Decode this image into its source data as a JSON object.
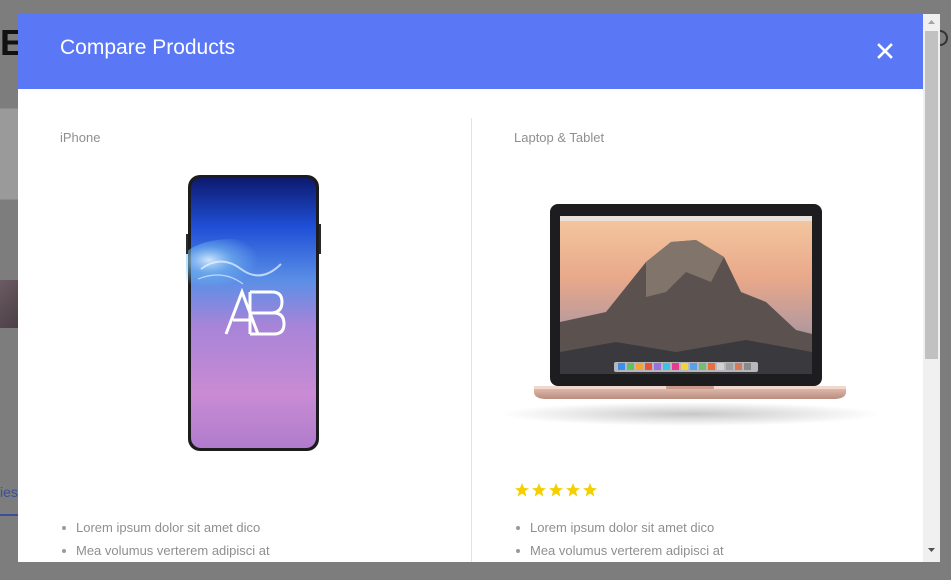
{
  "modal": {
    "title": "Compare Products",
    "close_icon": "close-icon"
  },
  "background": {
    "heading_fragment": "E",
    "link_fragment": "ies"
  },
  "products": [
    {
      "category": "iPhone",
      "image": "smartphone-image",
      "rating": null,
      "features": [
        "Lorem ipsum dolor sit amet dico",
        "Mea volumus verterem adipisci at"
      ]
    },
    {
      "category": "Laptop & Tablet",
      "image": "laptop-image",
      "rating": 5,
      "features": [
        "Lorem ipsum dolor sit amet dico",
        "Mea volumus verterem adipisci at"
      ]
    }
  ],
  "colors": {
    "header": "#5a78f5",
    "star": "#f5d000",
    "overlay": "#7d7d7d"
  }
}
